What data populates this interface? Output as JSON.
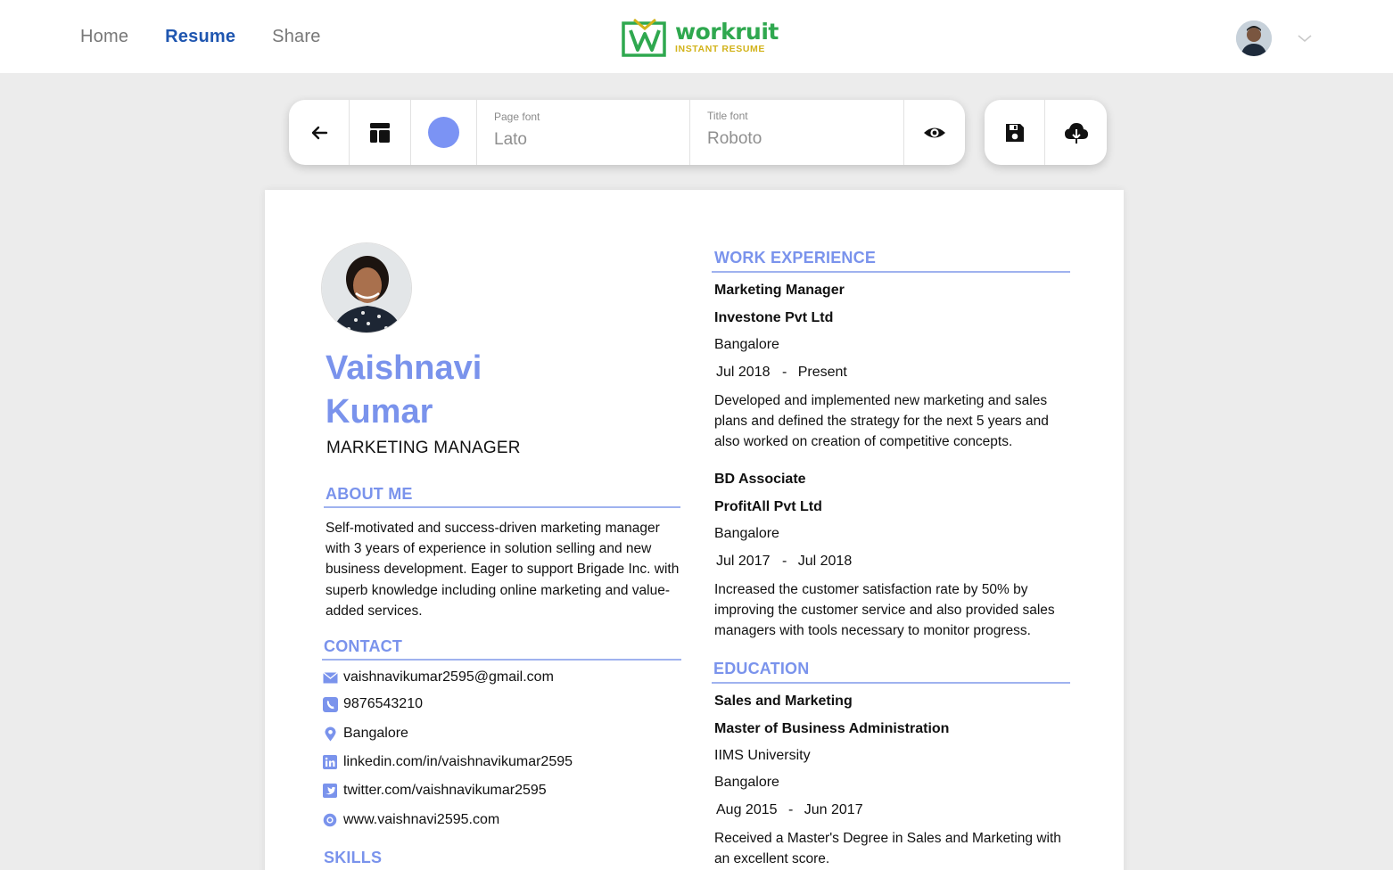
{
  "nav": {
    "home": "Home",
    "resume": "Resume",
    "share": "Share"
  },
  "logo": {
    "name": "workruit",
    "tagline": "INSTANT RESUME"
  },
  "toolbar": {
    "page_font_label": "Page font",
    "page_font_value": "Lato",
    "title_font_label": "Title font",
    "title_font_value": "Roboto",
    "accent_color": "#7a93ec"
  },
  "resume": {
    "first_name": "Vaishnavi",
    "last_name": "Kumar",
    "role": "MARKETING MANAGER",
    "about_title": "ABOUT ME",
    "about_text": "Self-motivated and success-driven marketing manager with 3 years of experience in solution selling and new business development. Eager to support Brigade Inc. with superb knowledge including online marketing and value-added services.",
    "contact_title": "CONTACT",
    "contact": {
      "email": "vaishnavikumar2595@gmail.com",
      "phone": "9876543210",
      "location": "Bangalore",
      "linkedin": "linkedin.com/in/vaishnavikumar2595",
      "twitter": "twitter.com/vaishnavikumar2595",
      "website": "www.vaishnavi2595.com"
    },
    "skills_title": "SKILLS",
    "work_title": "WORK EXPERIENCE",
    "jobs": [
      {
        "title": "Marketing Manager",
        "company": "Investone Pvt Ltd",
        "location": "Bangalore",
        "start": "Jul 2018",
        "sep": "-",
        "end": "Present",
        "description": "Developed and implemented new marketing and sales plans and defined the strategy for the next 5 years and also worked on creation of competitive concepts."
      },
      {
        "title": "BD Associate",
        "company": "ProfitAll Pvt Ltd",
        "location": "Bangalore",
        "start": "Jul 2017",
        "sep": "-",
        "end": "Jul 2018",
        "description": "Increased the customer satisfaction rate by 50% by improving the customer service and also provided sales managers with tools necessary to monitor progress."
      }
    ],
    "education_title": "EDUCATION",
    "education": {
      "field": "Sales and Marketing",
      "degree": "Master of Business Administration",
      "school": "IIMS University",
      "location": "Bangalore",
      "start": "Aug 2015",
      "sep": "-",
      "end": "Jun 2017",
      "description": "Received a Master's Degree in Sales and Marketing with an excellent score."
    }
  }
}
